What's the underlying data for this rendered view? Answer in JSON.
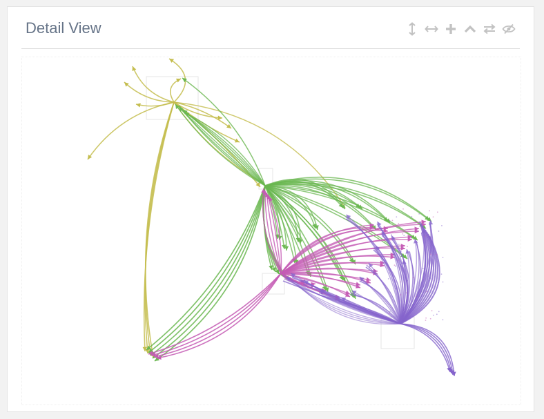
{
  "panel": {
    "title": "Detail View"
  },
  "toolbar": {
    "icons": [
      "expand-vertical-icon",
      "expand-horizontal-icon",
      "plus-icon",
      "chevron-up-icon",
      "swap-icon",
      "eye-slash-icon"
    ],
    "icon_color": "#c2c2c2"
  },
  "diagram": {
    "type": "edge-bundled flow diagram",
    "colors": {
      "olive": "#c4bd4e",
      "green": "#6ab750",
      "magenta": "#c45bb4",
      "purple": "#8564cc",
      "box": "#e6e6e6"
    }
  }
}
